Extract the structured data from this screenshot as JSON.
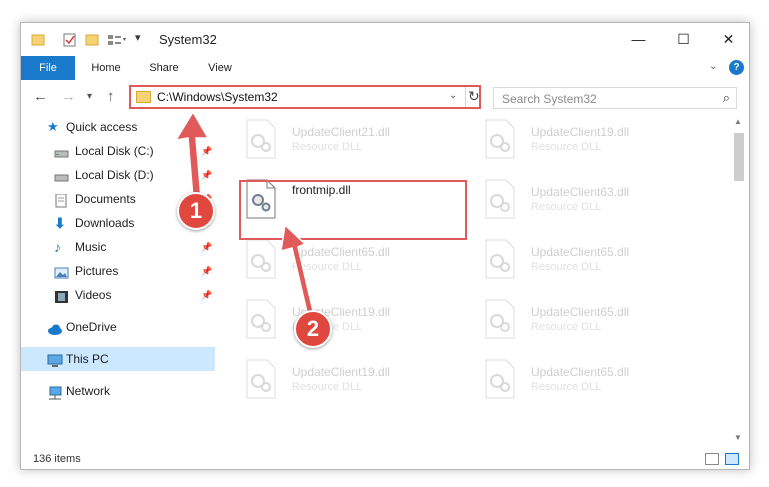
{
  "window": {
    "title": "System32",
    "controls": {
      "minimize": "—",
      "maximize": "☐",
      "close": "✕"
    }
  },
  "ribbon": {
    "tabs": [
      "File",
      "Home",
      "Share",
      "View"
    ],
    "expand_icon": "chevron-down-icon",
    "help_label": "?"
  },
  "address": {
    "path": "C:\\Windows\\System32",
    "search_placeholder": "Search System32"
  },
  "sidebar": {
    "items": [
      {
        "label": "Quick access",
        "icon": "star-icon",
        "pinned": false
      },
      {
        "label": "Local Disk (C:)",
        "icon": "drive-icon",
        "pinned": true
      },
      {
        "label": "Local Disk (D:)",
        "icon": "drive-icon",
        "pinned": true
      },
      {
        "label": "Documents",
        "icon": "documents-icon",
        "pinned": true
      },
      {
        "label": "Downloads",
        "icon": "download-icon",
        "pinned": true
      },
      {
        "label": "Music",
        "icon": "music-icon",
        "pinned": true
      },
      {
        "label": "Pictures",
        "icon": "pictures-icon",
        "pinned": true
      },
      {
        "label": "Videos",
        "icon": "videos-icon",
        "pinned": true
      },
      {
        "label": "OneDrive",
        "icon": "cloud-icon",
        "pinned": false
      },
      {
        "label": "This PC",
        "icon": "computer-icon",
        "pinned": false
      },
      {
        "label": "Network",
        "icon": "network-icon",
        "pinned": false
      }
    ]
  },
  "files": {
    "highlighted": {
      "name": "frontmip.dll"
    },
    "background": [
      {
        "name": "UpdateClient21.dll",
        "desc": "Resource DLL"
      },
      {
        "name": "UpdateClient19.dll",
        "desc": "Resource DLL"
      },
      {
        "name": "UpdateClient63.dll",
        "desc": "Resource DLL"
      },
      {
        "name": "UpdateClient65.dll",
        "desc": "Resource DLL"
      },
      {
        "name": "UpdateClient65.dll",
        "desc": "Resource DLL"
      },
      {
        "name": "UpdateClient19.dll",
        "desc": "Resource DLL"
      },
      {
        "name": "UpdateClient65.dll",
        "desc": "Resource DLL"
      },
      {
        "name": "UpdateClient19.dll",
        "desc": "Resource DLL"
      },
      {
        "name": "UpdateClient65.dll",
        "desc": "Resource DLL"
      }
    ]
  },
  "status": {
    "item_count": "136 items"
  },
  "callouts": {
    "step1": "1",
    "step2": "2"
  },
  "colors": {
    "accent": "#1979ca",
    "highlight": "#e05a5a",
    "badge": "#e0473e",
    "selected": "#cce8ff"
  }
}
